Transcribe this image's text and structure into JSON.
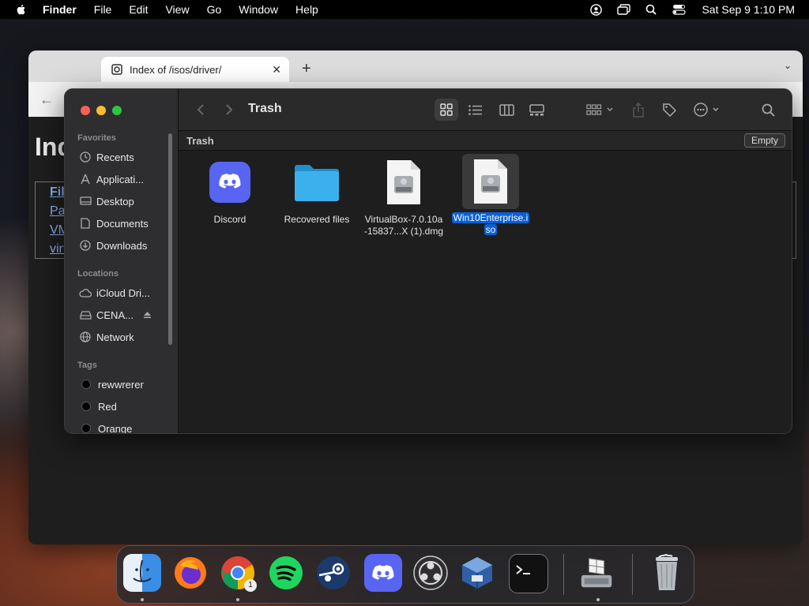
{
  "menubar": {
    "app": "Finder",
    "items": [
      "File",
      "Edit",
      "View",
      "Go",
      "Window",
      "Help"
    ],
    "clock": "Sat Sep 9  1:10 PM"
  },
  "browser": {
    "tab_title": "Index of /isos/driver/",
    "heading": "Ind",
    "links": [
      "File",
      "Par",
      "VM",
      "virt"
    ]
  },
  "finder": {
    "title": "Trash",
    "path_label": "Trash",
    "empty_button": "Empty",
    "sidebar": {
      "favorites_header": "Favorites",
      "favorites": [
        "Recents",
        "Applicati...",
        "Desktop",
        "Documents",
        "Downloads"
      ],
      "locations_header": "Locations",
      "locations": [
        "iCloud Dri...",
        "CENA...",
        "Network"
      ],
      "tags_header": "Tags",
      "tags": [
        {
          "label": "rewwrerer",
          "color": "#000000"
        },
        {
          "label": "Red",
          "color": "#000000"
        },
        {
          "label": "Orange",
          "color": "#000000"
        }
      ]
    },
    "files": [
      {
        "name_line1": "Discord",
        "name_line2": "",
        "icon": "discord-app-icon"
      },
      {
        "name_line1": "Recovered files",
        "name_line2": "",
        "icon": "folder-icon"
      },
      {
        "name_line1": "VirtualBox-7.0.10a",
        "name_line2": "-15837...X (1).dmg",
        "icon": "disk-image-icon"
      },
      {
        "name_line1": "Win10Enterprise.i",
        "name_line2": "so",
        "icon": "disk-image-icon",
        "selected": true
      }
    ]
  },
  "dock": {
    "apps": [
      "Finder",
      "Firefox",
      "Chrome",
      "Spotify",
      "Steam",
      "Discord",
      "OBS",
      "VirtualBox",
      "Terminal",
      "Boot Camp Assistant",
      "Trash"
    ],
    "chrome_badge": "1"
  },
  "colors": {
    "accent": "#0a5fd6",
    "close": "#ff5f57",
    "minimize": "#febc2e",
    "zoom": "#28c840",
    "folder": "#33a9e6",
    "discord": "#5865f2"
  }
}
